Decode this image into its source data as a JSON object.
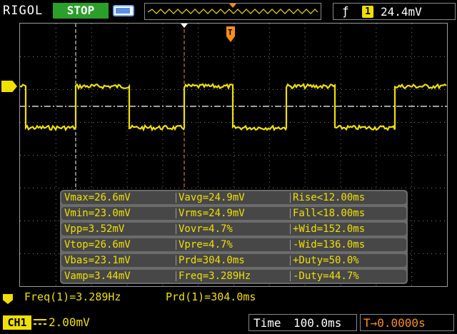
{
  "top": {
    "brand": "RIGOL",
    "run_state": "STOP",
    "trigger_level": "24.4mV",
    "trigger_channel": "1",
    "trigger_edge_icon": "rising-edge-icon",
    "trigger_marker": "T"
  },
  "measurements": {
    "rows": [
      [
        "Vmax=26.6mV",
        "Vavg=24.9mV",
        "Rise<12.00ms"
      ],
      [
        "Vmin=23.0mV",
        "Vrms=24.9mV",
        "Fall<18.00ms"
      ],
      [
        "Vpp=3.52mV",
        "Vovr=4.7%",
        "+Wid=152.0ms"
      ],
      [
        "Vtop=26.6mV",
        "Vpre=4.7%",
        "-Wid=136.0ms"
      ],
      [
        "Vbas=23.1mV",
        "Prd=304.0ms",
        "+Duty=50.0%"
      ],
      [
        "Vamp=3.44mV",
        "Freq=3.289Hz",
        "-Duty=44.7%"
      ]
    ]
  },
  "stats": {
    "freq": "Freq(1)=3.289Hz",
    "prd": "Prd(1)=304.0ms"
  },
  "status": {
    "channel": "CH1",
    "coupling_icon": "dc-coupling-icon",
    "vertical_scale": "2.00mV",
    "time_label": "Time",
    "time_scale": "100.0ms",
    "trigger_offset": "T→0.0000s"
  },
  "colors": {
    "trace": "#f0e000",
    "grid": "#9a9a9a",
    "trigger": "#ff8c1a",
    "cursor": "#ffffff"
  }
}
